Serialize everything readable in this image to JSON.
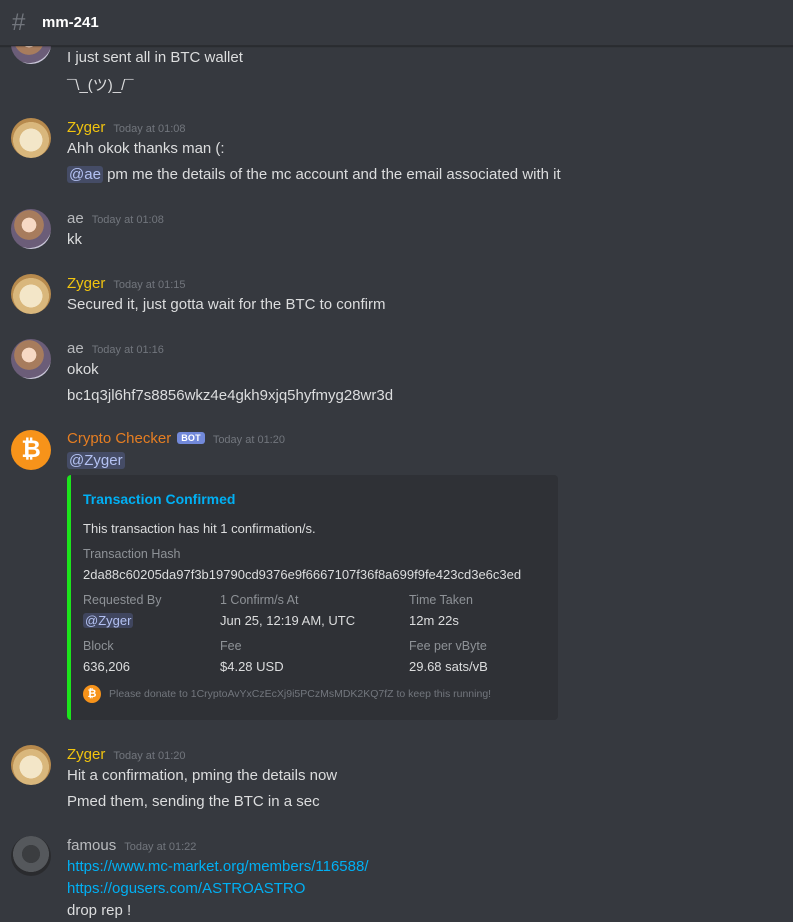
{
  "channel": {
    "name": "mm-241"
  },
  "messages": {
    "prev_lines": [
      "I just sent all in BTC wallet",
      "¯\\_(ツ)_/¯"
    ],
    "m1": {
      "author": "Zyger",
      "time": "Today at 01:08",
      "line1": "Ahh okok thanks man (:",
      "mention": "@ae",
      "line2_rest": " pm me the details of the mc account and the email associated with it"
    },
    "m2": {
      "author": "ae",
      "time": "Today at 01:08",
      "line1": "kk"
    },
    "m3": {
      "author": "Zyger",
      "time": "Today at 01:15",
      "line1": "Secured it, just gotta wait for the BTC to confirm"
    },
    "m4": {
      "author": "ae",
      "time": "Today at 01:16",
      "line1": "okok",
      "line2": "bc1q3jl6hf7s8856wkz4e4gkh9xjq5hyfmyg28wr3d"
    },
    "m5": {
      "author": "Crypto Checker",
      "bot_tag": "BOT",
      "time": "Today at 01:20",
      "mention": "@Zyger"
    },
    "m6": {
      "author": "Zyger",
      "time": "Today at 01:20",
      "line1": "Hit a confirmation, pming the details now",
      "line2": "Pmed them, sending the BTC in a sec"
    },
    "m7": {
      "author": "famous",
      "time": "Today at 01:22",
      "link1": "https://www.mc-market.org/members/116588/",
      "link2": "https://ogusers.com/ASTROASTRO",
      "line3": "drop rep !"
    }
  },
  "embed": {
    "title": "Transaction Confirmed",
    "description": "This transaction has hit 1 confirmation/s.",
    "hash_label": "Transaction Hash",
    "hash_value": "2da88c60205da97f3b19790cd9376e9f6667107f36f8a699f9fe423cd3e6c3ed",
    "requested_by_label": "Requested By",
    "requested_by_value": "@Zyger",
    "confirm_at_label": "1 Confirm/s At",
    "confirm_at_value": "Jun 25, 12:19 AM, UTC",
    "time_taken_label": "Time Taken",
    "time_taken_value": "12m 22s",
    "block_label": "Block",
    "block_value": "636,206",
    "fee_label": "Fee",
    "fee_value": "$4.28 USD",
    "fee_vbyte_label": "Fee per vByte",
    "fee_vbyte_value": "29.68 sats/vB",
    "footer": "Please donate to 1CryptoAvYxCzEcXj9i5PCzMsMDK2KQ7fZ to keep this running!"
  },
  "icons": {
    "channel": "hash-icon",
    "bitcoin": "bitcoin-icon"
  },
  "colors": {
    "zyger": "#f1c40f",
    "crypto_checker": "#e67e22",
    "ae": "#b9bbbe",
    "famous": "#b9bbbe",
    "embed_accent": "#1ce41c",
    "link": "#00b0f4"
  }
}
